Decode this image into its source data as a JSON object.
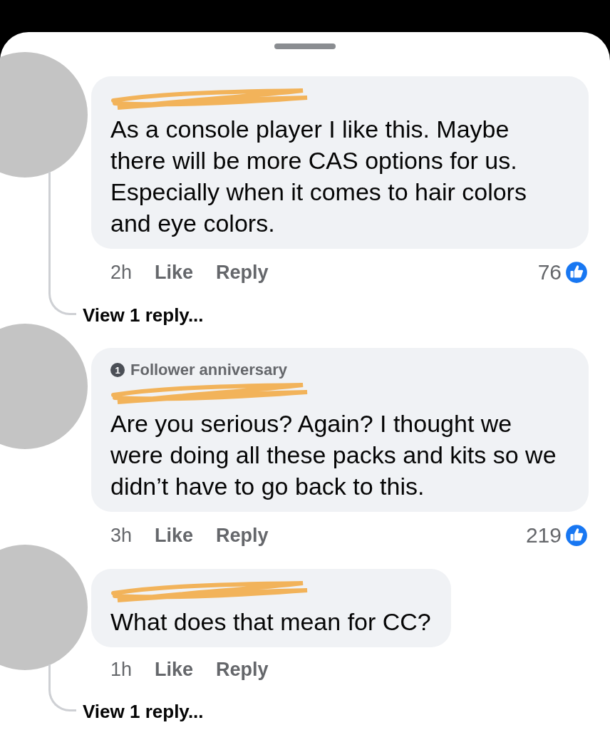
{
  "comments": [
    {
      "name_redacted": true,
      "text": "As a console player I like this. Maybe there will be more CAS options for us. Especially when it comes to hair colors and eye colors.",
      "time": "2h",
      "actions": [
        "Like",
        "Reply"
      ],
      "reaction_count": "76",
      "replies_link": "View 1 reply..."
    },
    {
      "badge": {
        "number": "1",
        "label": "Follower anniversary"
      },
      "name_redacted": true,
      "text": "Are you serious? Again? I thought we were doing all these packs and kits so we didn’t have to go back to this.",
      "time": "3h",
      "actions": [
        "Like",
        "Reply"
      ],
      "reaction_count": "219"
    },
    {
      "name_redacted": true,
      "text": "What does that mean for CC?",
      "time": "1h",
      "actions": [
        "Like",
        "Reply"
      ],
      "replies_link": "View 1 reply..."
    }
  ]
}
